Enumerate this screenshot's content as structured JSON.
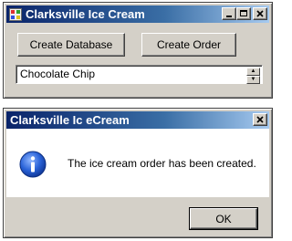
{
  "main_window": {
    "title": "Clarksville Ice Cream",
    "buttons": {
      "create_database": "Create Database",
      "create_order": "Create Order"
    },
    "flavor_selector": {
      "value": "Chocolate Chip"
    }
  },
  "dialog": {
    "title": "Clarksville Ic eCream",
    "message": "The ice cream order has been created.",
    "ok_label": "OK",
    "icon": "info-icon"
  },
  "colors": {
    "titlebar_start": "#0a246a",
    "titlebar_end": "#a6caf0",
    "face": "#d4d0c8",
    "dialog_body": "#ffffff"
  }
}
